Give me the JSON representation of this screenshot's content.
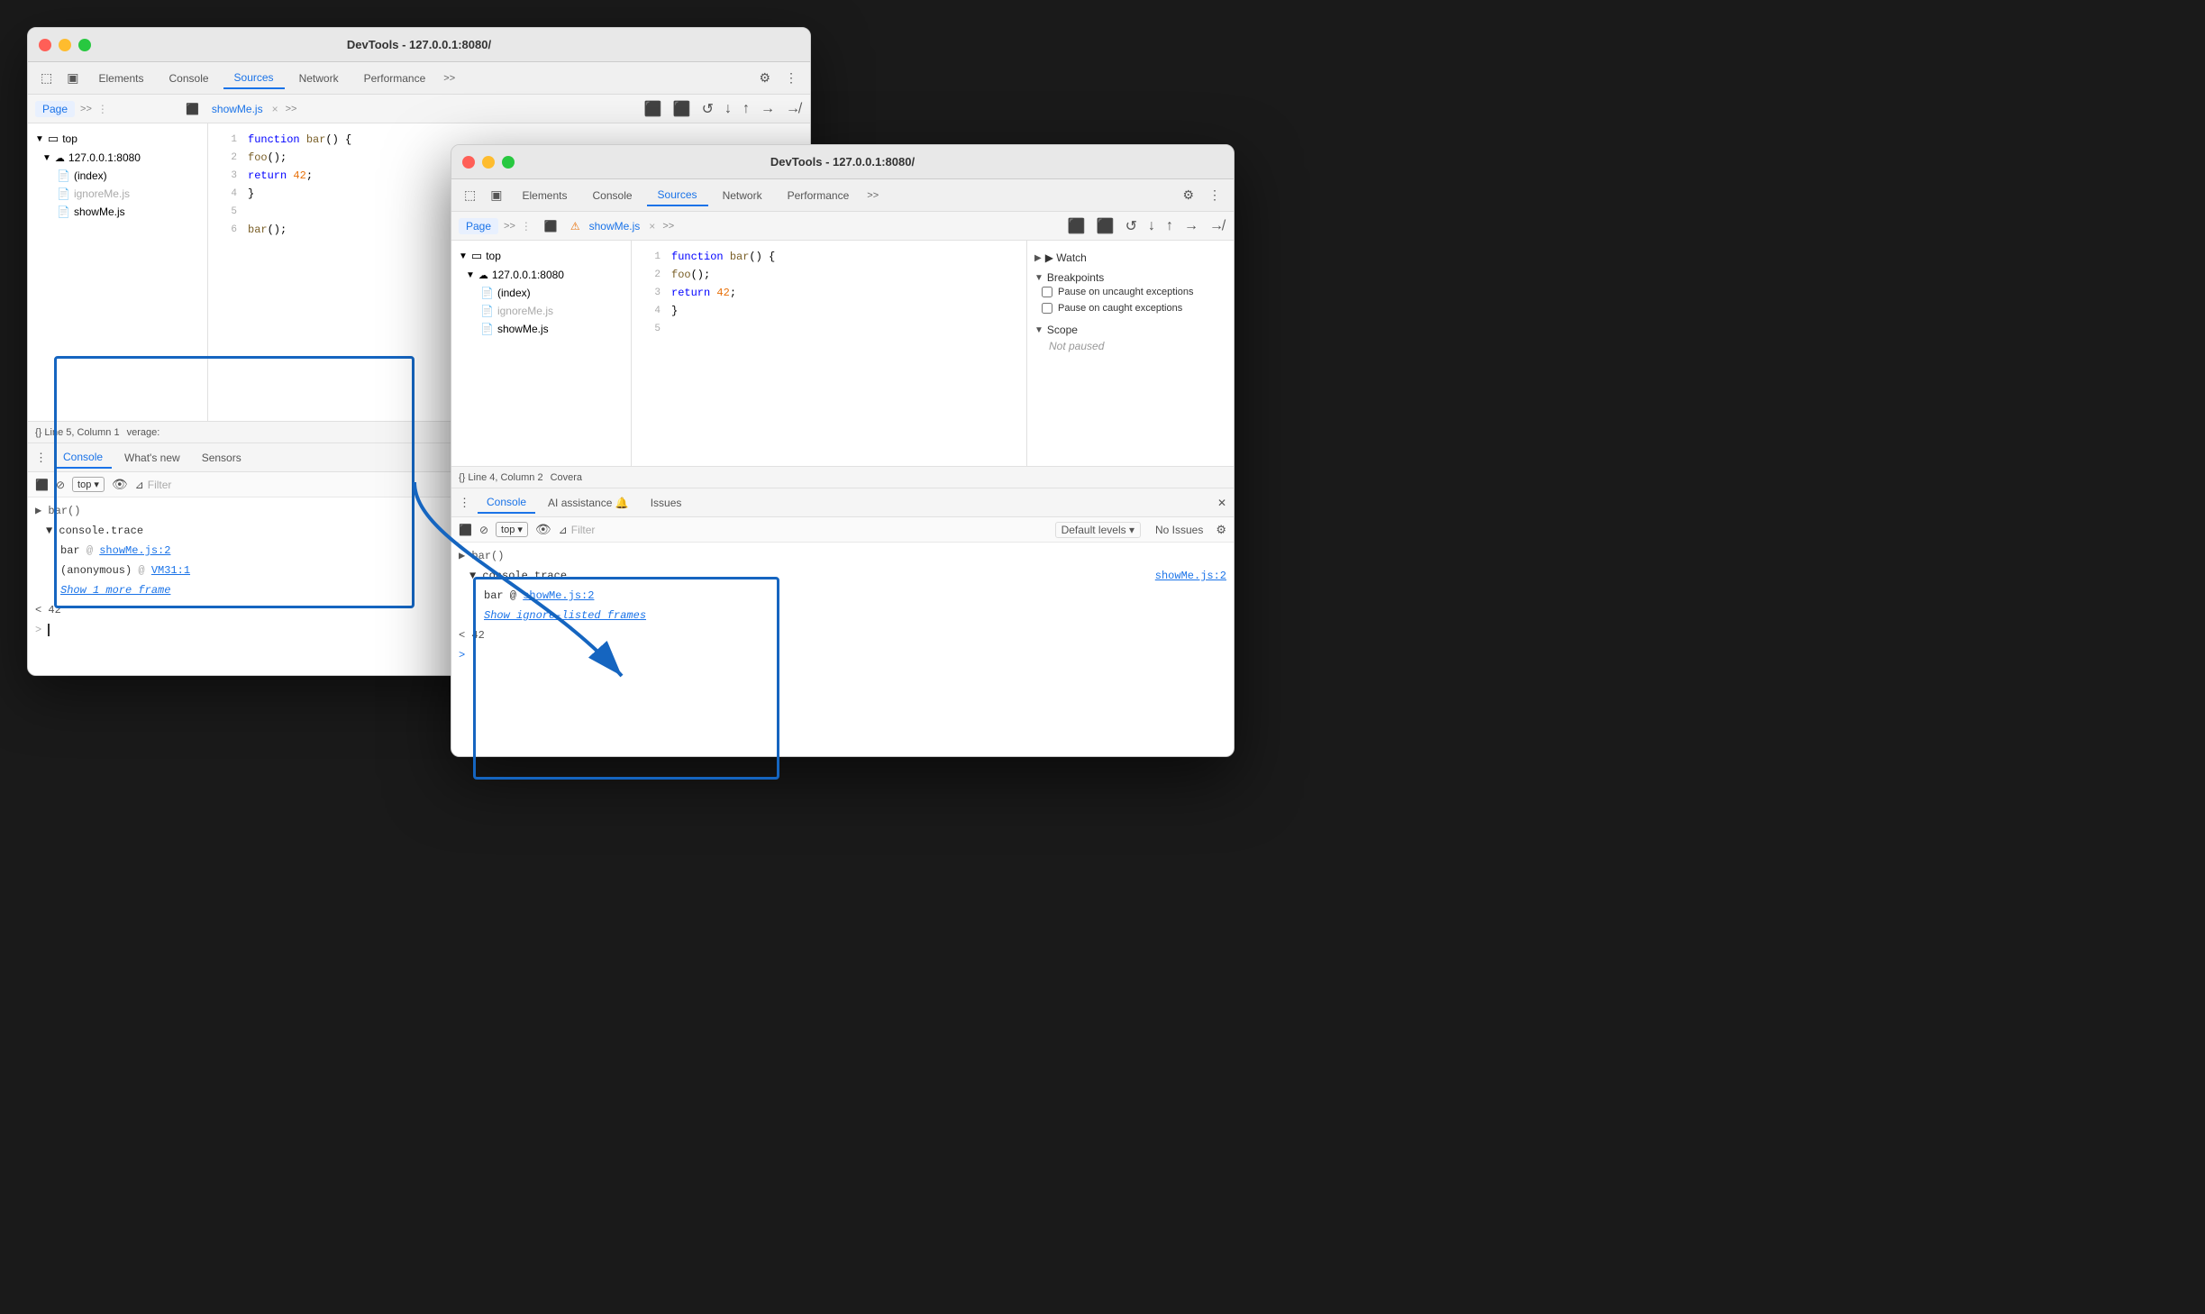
{
  "back_window": {
    "title": "DevTools - 127.0.0.1:8080/",
    "tabs": [
      "inspector-icon",
      "responsive-icon",
      "Elements",
      "Console",
      "Sources",
      "Network",
      "Performance",
      "more"
    ],
    "sources_active": true,
    "toolbar_secondary": {
      "page_label": "Page",
      "file_tab": "showMe.js",
      "close": "×"
    },
    "file_tree": {
      "top": "top",
      "server": "127.0.0.1:8080",
      "files": [
        "(index)",
        "ignoreMe.js",
        "showMe.js"
      ]
    },
    "code": {
      "lines": [
        {
          "num": "1",
          "text": "function bar() {"
        },
        {
          "num": "2",
          "text": "  foo();"
        },
        {
          "num": "3",
          "text": "  return 42;"
        },
        {
          "num": "4",
          "text": "}"
        },
        {
          "num": "5",
          "text": ""
        },
        {
          "num": "6",
          "text": "bar();"
        }
      ]
    },
    "status_bar": {
      "text": "{} Line 5, Column 1",
      "coverage": "verage:"
    },
    "console_tabs": [
      "Console",
      "What's new",
      "Sensors"
    ],
    "console_toolbar": {
      "top_label": "top",
      "filter_placeholder": "Filter"
    },
    "console_entries": [
      {
        "type": "group",
        "text": "> bar()"
      },
      {
        "type": "trace_header",
        "text": "▼ console.trace"
      },
      {
        "type": "trace_entry",
        "label": "bar",
        "link": "showMe.js:2"
      },
      {
        "type": "trace_entry",
        "label": "(anonymous)",
        "link": "VM31:1"
      },
      {
        "type": "show_more",
        "text": "Show 1 more frame"
      },
      {
        "type": "result",
        "text": "< 42"
      },
      {
        "type": "prompt",
        "text": ">"
      }
    ]
  },
  "front_window": {
    "title": "DevTools - 127.0.0.1:8080/",
    "tabs": [
      "inspector-icon",
      "responsive-icon",
      "Elements",
      "Console",
      "Sources",
      "Network",
      "Performance",
      "more"
    ],
    "sources_active": true,
    "toolbar_secondary": {
      "page_label": "Page",
      "file_tab": "showMe.js",
      "warning": "⚠",
      "close": "×"
    },
    "file_tree": {
      "top": "top",
      "server": "127.0.0.1:8080",
      "files": [
        "(index)",
        "ignoreMe.js",
        "showMe.js"
      ]
    },
    "code": {
      "lines": [
        {
          "num": "1",
          "text": "function bar() {"
        },
        {
          "num": "2",
          "text": "  foo();"
        },
        {
          "num": "3",
          "text": "  return 42;"
        },
        {
          "num": "4",
          "text": "}"
        },
        {
          "num": "5",
          "text": ""
        }
      ]
    },
    "status_bar": {
      "text": "{} Line 4, Column 2",
      "coverage": "Covera"
    },
    "console_tabs": [
      "Console",
      "AI assistance 🔔",
      "Issues"
    ],
    "console_toolbar": {
      "top_label": "top",
      "filter_placeholder": "Filter",
      "default_levels": "Default levels",
      "no_issues": "No Issues"
    },
    "console_entries": [
      {
        "type": "group",
        "text": "▶ bar()"
      },
      {
        "type": "trace_header",
        "text": "▼ console.trace"
      },
      {
        "type": "trace_entry",
        "label": "bar @",
        "link": "showMe.js:2"
      },
      {
        "type": "show_more",
        "text": "Show ignore-listed frames"
      },
      {
        "type": "result",
        "text": "< 42"
      },
      {
        "type": "prompt",
        "text": ">"
      }
    ],
    "console_link_right": "showMe.js:2",
    "debugger": {
      "watch_label": "▶ Watch",
      "breakpoints_label": "▼ Breakpoints",
      "pause_uncaught": "Pause on uncaught exceptions",
      "pause_caught": "Pause on caught exceptions",
      "scope_label": "▼ Scope",
      "not_paused": "Not paused"
    }
  },
  "arrow": {
    "description": "blue arrow pointing from back console to front console"
  }
}
